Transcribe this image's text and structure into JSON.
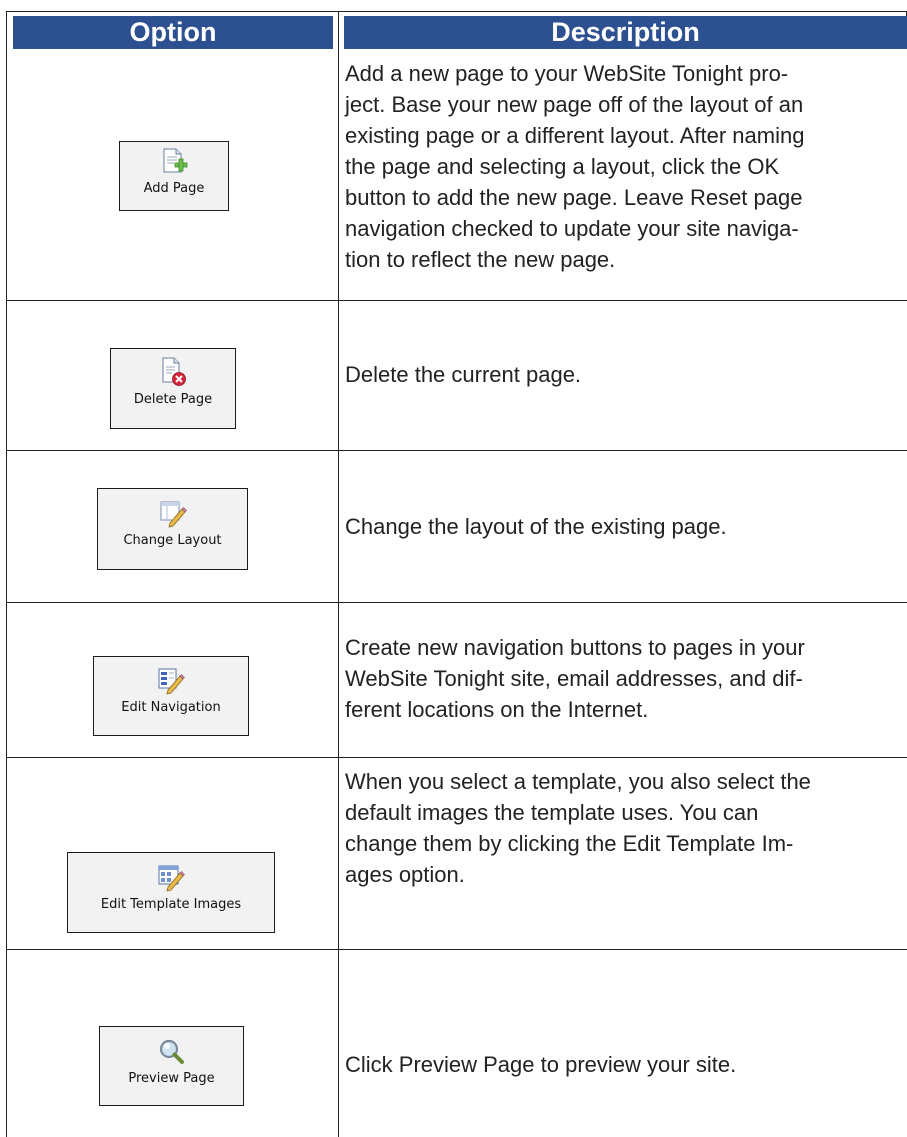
{
  "header": {
    "option": "Option",
    "description": "Description"
  },
  "rows": [
    {
      "button_label": "Add Page",
      "icon": "add-page-icon",
      "description": "Add a new page to your WebSite Tonight pro-\nject. Base your new page off of the layout of an\nexisting page or a different layout. After naming\nthe page and selecting a layout, click the OK\nbutton to add the new page. Leave Reset page\nnavigation checked to update your site naviga-\ntion to reflect the new page."
    },
    {
      "button_label": "Delete Page",
      "icon": "delete-page-icon",
      "description": "Delete the current page."
    },
    {
      "button_label": "Change Layout",
      "icon": "change-layout-icon",
      "description": "Change the layout of the existing page."
    },
    {
      "button_label": "Edit Navigation",
      "icon": "edit-navigation-icon",
      "description": "Create new navigation buttons to pages in your\nWebSite Tonight site, email addresses, and dif-\nferent locations on the Internet."
    },
    {
      "button_label": "Edit Template Images",
      "icon": "edit-template-images-icon",
      "description": "When you select a template, you also select the\ndefault images the template uses. You can\nchange them by clicking the Edit Template Im-\nages option."
    },
    {
      "button_label": "Preview Page",
      "icon": "magnifier-icon",
      "description": "Click Preview Page to preview your site."
    }
  ],
  "colors": {
    "header_bg": "#2d5190",
    "header_text": "#ffffff",
    "button_bg": "#f2f2f2"
  }
}
